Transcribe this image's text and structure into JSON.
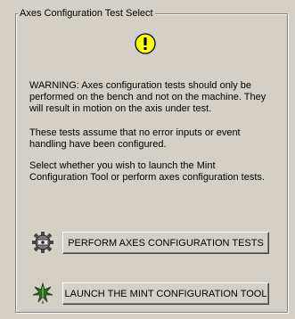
{
  "group": {
    "title": "Axes Configuration Test Select"
  },
  "icons": {
    "warning": "warning-icon",
    "axes_test": "motor-gear-icon",
    "mint_config": "mint-leaf-icon"
  },
  "colors": {
    "warning_yellow": "#ffff00",
    "background": "#d4d0c8"
  },
  "paragraphs": {
    "warning": "WARNING: Axes configuration tests should only be performed on the bench and not on the machine. They will result in motion on the axis under test.",
    "assumption": "These tests assume that no error inputs or event handling have been configured.",
    "instruction": "Select whether you wish to launch the Mint Configuration Tool or perform axes configuration tests."
  },
  "buttons": {
    "perform_tests": "PERFORM AXES CONFIGURATION TESTS",
    "launch_tool": "LAUNCH THE MINT CONFIGURATION TOOL"
  }
}
